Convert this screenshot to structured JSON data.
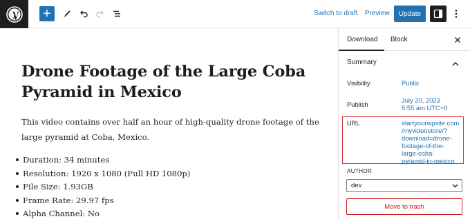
{
  "toolbar": {
    "add_label": "+",
    "switch_to_draft_label": "Switch to draft",
    "preview_label": "Preview",
    "update_label": "Update",
    "icons": [
      "wordpress-logo",
      "plus",
      "pencil-tools",
      "undo",
      "redo",
      "list-view",
      "sidebar-toggle",
      "more-vertical"
    ]
  },
  "post": {
    "title": "Drone Footage of the Large Coba Pyramid in Mexico",
    "paragraph": "This video contains over half an hour of high-quality drone footage of the large pyramid at Coba, Mexico.",
    "list": [
      "Duration: 34 minutes",
      "Resolution: 1920 x 1080 (Full HD 1080p)",
      "File Size: 1.93GB",
      "Frame Rate: 29.97 fps",
      "Alpha Channel: No"
    ]
  },
  "sidebar": {
    "tabs": [
      {
        "label": "Download",
        "active": true
      },
      {
        "label": "Block",
        "active": false
      }
    ],
    "summary_title": "Summary",
    "visibility": {
      "label": "Visibility",
      "value": "Public"
    },
    "publish": {
      "label": "Publish",
      "value_line1": "July 20, 2023",
      "value_line2": "5:55 am UTC+0"
    },
    "url": {
      "label": "URL",
      "lines": [
        "startyourwpsite.com",
        "/myvideostore/?",
        "download=drone-",
        "footage-of-the-",
        "large-coba-",
        "pyramid-in-mexico"
      ]
    },
    "author_label": "AUTHOR",
    "author_value": "dev",
    "trash_label": "Move to trash"
  },
  "colors": {
    "accent": "#2271b1",
    "dark": "#1e1e1e",
    "highlight_border": "#d63638",
    "danger": "#cc1818"
  }
}
